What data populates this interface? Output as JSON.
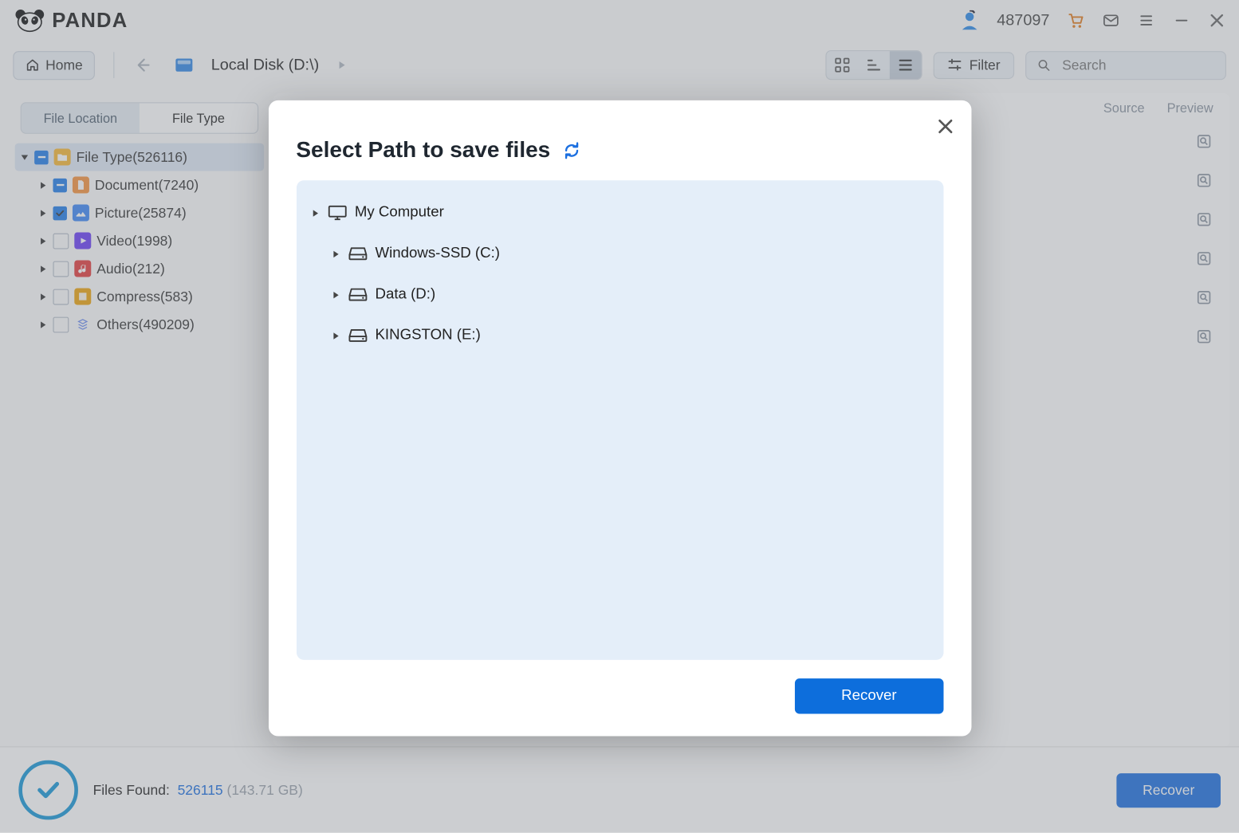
{
  "brand": "PANDA",
  "header": {
    "user_number": "487097"
  },
  "toolbar": {
    "home": "Home",
    "breadcrumb": "Local Disk (D:\\)",
    "filter": "Filter",
    "search_placeholder": "Search"
  },
  "sidebar": {
    "tabs": {
      "location": "File Location",
      "type": "File Type"
    },
    "root": {
      "label": "File Type(526116)"
    },
    "items": [
      {
        "label": "Document(7240)"
      },
      {
        "label": "Picture(25874)"
      },
      {
        "label": "Video(1998)"
      },
      {
        "label": "Audio(212)"
      },
      {
        "label": "Compress(583)"
      },
      {
        "label": "Others(490209)"
      }
    ]
  },
  "right": {
    "source": "Source",
    "preview": "Preview"
  },
  "status": {
    "label": "Files Found:",
    "count": "526115",
    "size": "(143.71 GB)",
    "recover": "Recover"
  },
  "modal": {
    "title": "Select Path to save files",
    "root": "My Computer",
    "drives": [
      {
        "label": "Windows-SSD (C:)"
      },
      {
        "label": "Data (D:)"
      },
      {
        "label": "KINGSTON (E:)"
      }
    ],
    "recover": "Recover"
  }
}
